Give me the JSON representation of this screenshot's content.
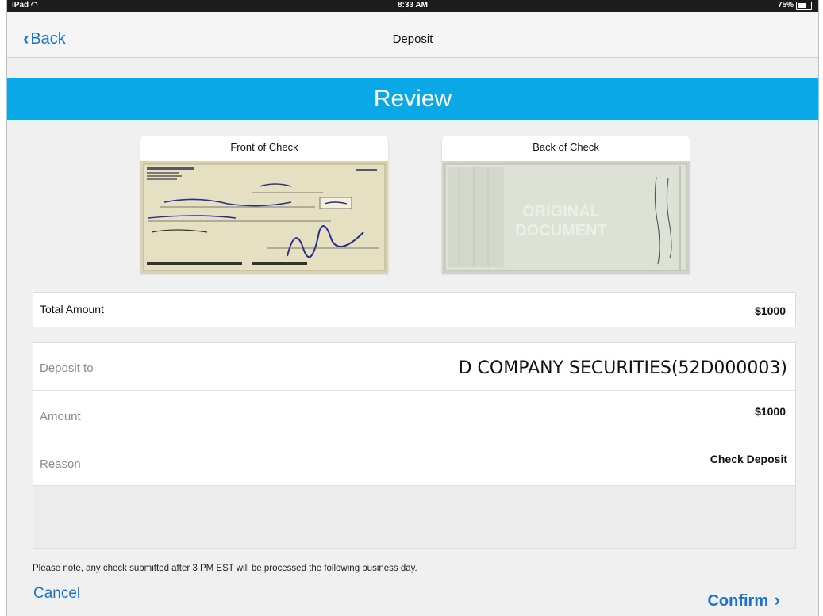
{
  "status": {
    "carrier": "iPad",
    "time": "8:33 AM",
    "battery": "75%"
  },
  "nav": {
    "back_label": "Back",
    "title": "Deposit"
  },
  "review": {
    "title": "Review"
  },
  "checks": {
    "front_label": "Front of Check",
    "back_label": "Back of Check"
  },
  "total": {
    "label": "Total Amount",
    "value": "$1000"
  },
  "details": {
    "deposit_to_label": "Deposit to",
    "deposit_to_value": "D COMPANY SECURITIES(52D000003)",
    "amount_label": "Amount",
    "amount_value": "$1000",
    "reason_label": "Reason",
    "reason_value": "Check Deposit"
  },
  "footer": {
    "note": "Please note, any check submitted after 3 PM EST will be processed the following business day.",
    "cancel_label": "Cancel",
    "confirm_label": "Confirm",
    "confirm_icon": "chevron-right-icon"
  },
  "colors": {
    "accent": "#1a73c8",
    "review_bar": "#0aa8e6"
  }
}
